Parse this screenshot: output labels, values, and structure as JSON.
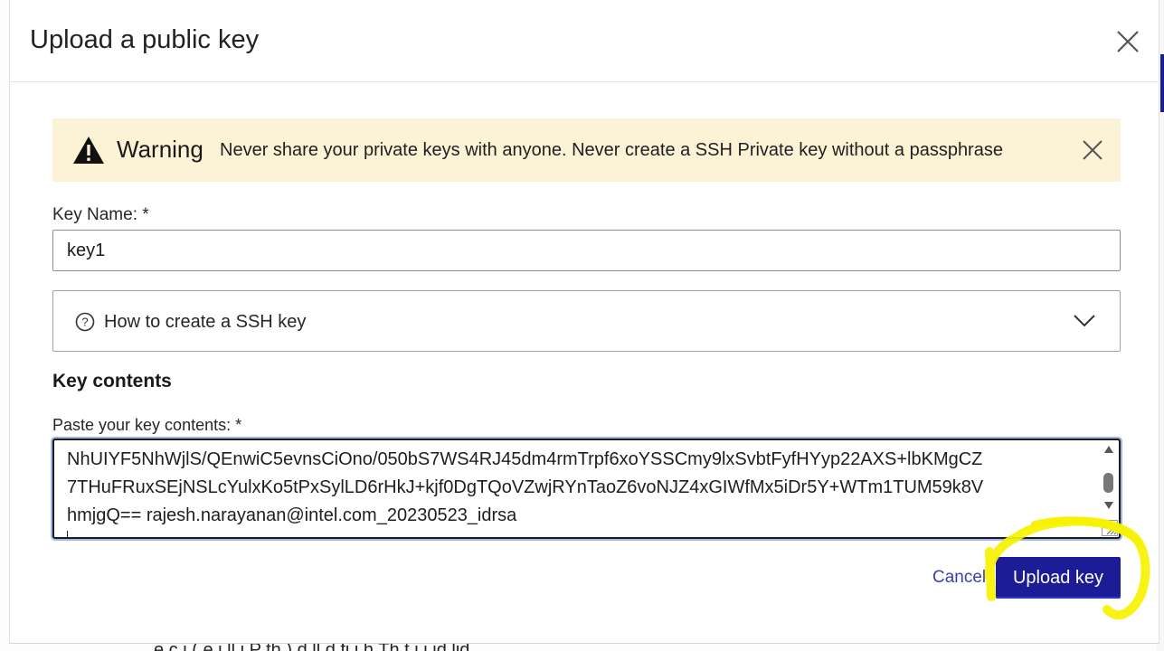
{
  "modal": {
    "title": "Upload a public key"
  },
  "warning": {
    "title": "Warning",
    "message": "Never share your private keys with anyone. Never create a SSH Private key without a passphrase"
  },
  "key_name": {
    "label": "Key Name: *",
    "value": "key1"
  },
  "accordion": {
    "label": "How to create a SSH key"
  },
  "key_contents": {
    "heading": "Key contents",
    "label": "Paste your key contents: *",
    "lines": [
      "NhUIYF5NhWjlS/QEnwiC5evnsCiOno/050bS7WS4RJ45dm4rmTrpf6xoYSSCmy9lxSvbtFyfHYyp22AXS+lbKMgCZ",
      "7THuFRuxSEjNSLcYulxKo5tPxSylLD6rHkJ+kjf0DgTQoVZwjRYnTaoZ6voNJZ4xGIWfMx5iDr5Y+WTm1TUM59k8V",
      "hmjgQ== rajesh.narayanan@intel.com_20230523_idrsa"
    ]
  },
  "actions": {
    "cancel_label": "Cancel",
    "upload_label": "Upload key"
  },
  "background": {
    "partial_text": "e   c  i  (  e  i  ll  i  P  th  )    d  ll  d   fi i h  Th  t  i i     id     lid"
  },
  "colors": {
    "primary_button": "#1c1d96",
    "cancel_link": "#3b3fb0",
    "warning_bg": "#fcf3d7",
    "highlight": "#f6f200"
  },
  "icons": {
    "close": "close-icon",
    "warning": "warning-triangle-icon",
    "help": "question-circle-icon",
    "chevron": "chevron-down-icon"
  }
}
